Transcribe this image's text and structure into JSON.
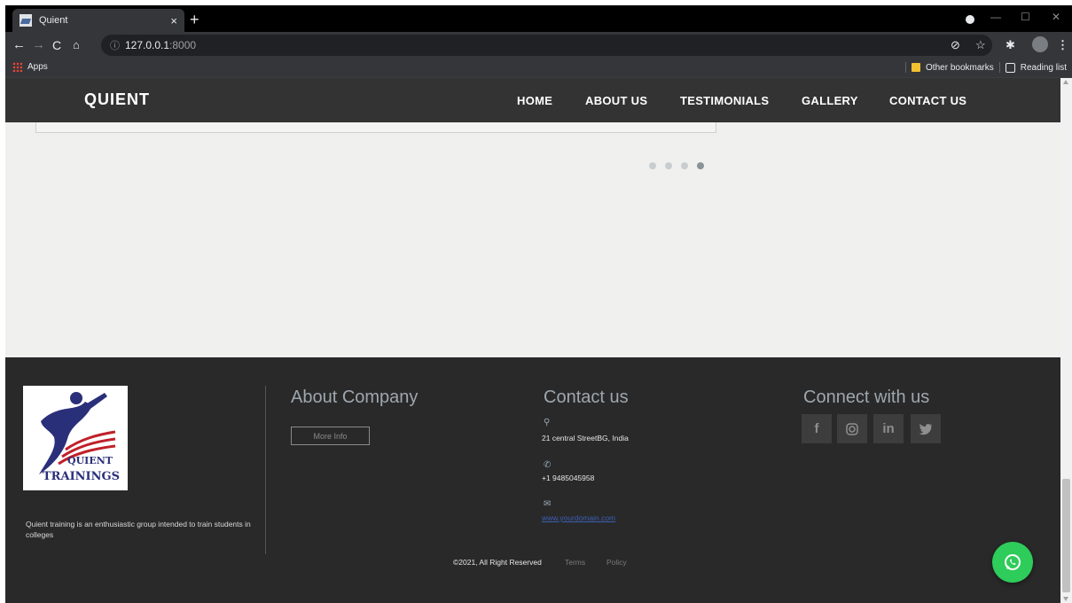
{
  "browser": {
    "tab_title": "Quient",
    "tab_close": "×",
    "new_tab": "+",
    "url_host": "127.0.0.1",
    "url_port": ":8000",
    "bookmarks": {
      "apps_label": "Apps",
      "other_bookmarks": "Other bookmarks",
      "reading_list": "Reading list"
    }
  },
  "site": {
    "brand": "QUIENT",
    "nav": [
      "HOME",
      "ABOUT US",
      "TESTIMONIALS",
      "GALLERY",
      "CONTACT US"
    ],
    "carousel": {
      "slides": 4,
      "active_index": 3
    }
  },
  "footer": {
    "logo_text_line1": "QUIENT",
    "logo_text_line2": "TRAININGS",
    "about_text": "Quient training is an enthusiastic group intended to train students in colleges",
    "about_company_title": "About Company",
    "more_info": "More Info",
    "contact_title": "Contact us",
    "address": "21 central StreetBG, India",
    "phone": "+1 9485045958",
    "website": "www.yourdomain.com",
    "connect_title": "Connect with us",
    "social": [
      {
        "icon": "facebook-icon",
        "glyph": "f"
      },
      {
        "icon": "instagram-icon",
        "glyph": "◎"
      },
      {
        "icon": "linkedin-icon",
        "glyph": "in"
      },
      {
        "icon": "twitter-icon",
        "glyph": "🐦"
      }
    ],
    "copyright": "©2021, All Right Reserved",
    "terms": "Terms",
    "policy": "Policy"
  },
  "colors": {
    "nav_bg": "#333333",
    "footer_bg": "#292929",
    "whatsapp": "#2ecc5a",
    "logo_blue": "#2a2f7a",
    "logo_red": "#c0202a"
  }
}
